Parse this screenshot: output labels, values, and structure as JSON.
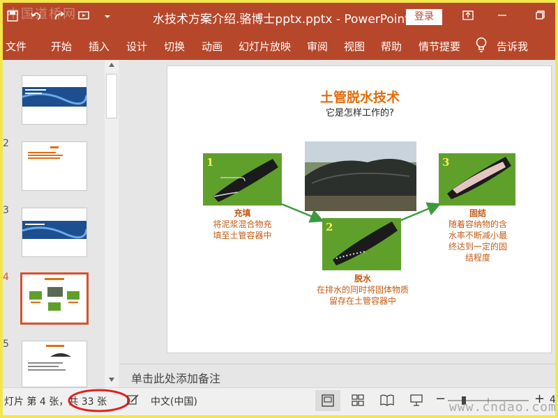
{
  "window": {
    "title": "水技术方案介绍.骆博士pptx.pptx  -  PowerPoint",
    "login_label": "登录",
    "watermark_top": "中国道桥网",
    "watermark_bottom": "www.cndao.com"
  },
  "ribbon": {
    "tabs": [
      "文件",
      "开始",
      "插入",
      "设计",
      "切换",
      "动画",
      "幻灯片放映",
      "审阅",
      "视图",
      "帮助",
      "情节提要"
    ],
    "tell_me": "告诉我"
  },
  "thumbnails": {
    "numbers": [
      "2",
      "3",
      "4",
      "5"
    ],
    "selected_index": 4
  },
  "slide": {
    "title": "土管脱水技术",
    "subtitle": "它是怎样工作的?",
    "steps": [
      {
        "number": "1",
        "name": "充填",
        "desc_line1": "将泥浆混合物充",
        "desc_line2": "填至土管容器中"
      },
      {
        "number": "2",
        "name": "脱水",
        "desc_line1": "在排水的同时将固体物质",
        "desc_line2": "留存在土管容器中"
      },
      {
        "number": "3",
        "name": "固结",
        "desc_line1": "随着容纳物的含",
        "desc_line2": "水率不断减小最",
        "desc_line3": "终达到一定的固",
        "desc_line4": "结程度"
      }
    ]
  },
  "notes": {
    "placeholder": "单击此处添加备注"
  },
  "status": {
    "slide_info": "灯片 第 4 张，共 33 张",
    "language": "中文(中国)",
    "zoom_minus": "−",
    "zoom_plus": "+",
    "zoom_partial": "4"
  },
  "colors": {
    "accent": "#b7472a",
    "title_orange": "#e46c0a",
    "label_orange": "#c55a11",
    "green": "#5fa02a",
    "highlight_red": "#e0201c"
  }
}
